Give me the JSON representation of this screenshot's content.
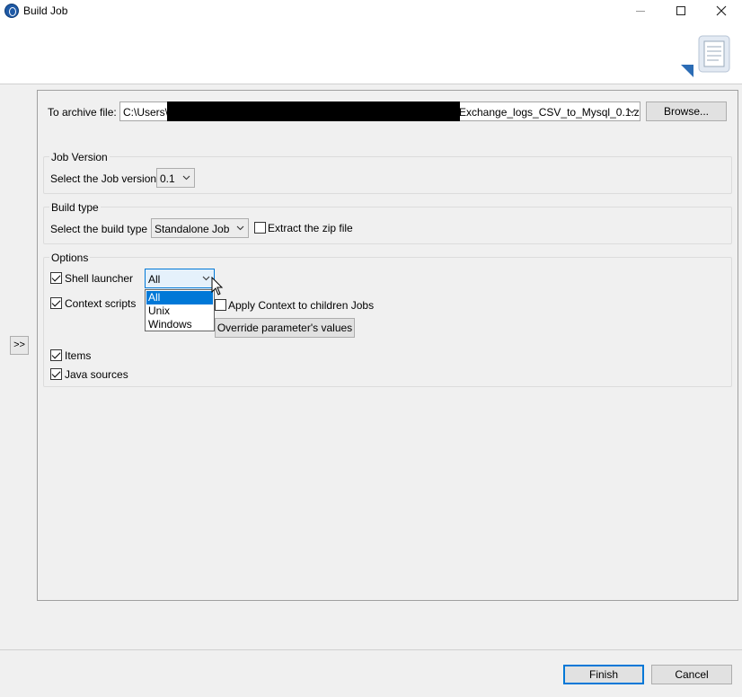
{
  "window": {
    "title": "Build Job"
  },
  "side_toggle": {
    "label": ">>"
  },
  "archive": {
    "label": "To archive file:",
    "path_start": "C:\\Users\\",
    "path_end": "Exchange_logs_CSV_to_Mysql_0.1.z",
    "browse_label": "Browse..."
  },
  "job_version": {
    "legend": "Job Version",
    "label": "Select the Job version",
    "value": "0.1"
  },
  "build_type": {
    "legend": "Build type",
    "label": "Select the build type",
    "value": "Standalone Job",
    "extract_label": "Extract the zip file",
    "extract_checked": false
  },
  "options": {
    "legend": "Options",
    "shell_launcher_label": "Shell launcher",
    "shell_launcher_value": "All",
    "shell_launcher_options": [
      "All",
      "Unix",
      "Windows"
    ],
    "context_scripts_label": "Context scripts",
    "apply_context_label": "Apply Context to children Jobs",
    "override_label": "Override parameter's values",
    "items_label": "Items",
    "java_sources_label": "Java sources"
  },
  "footer": {
    "finish_label": "Finish",
    "cancel_label": "Cancel"
  },
  "colors": {
    "accent": "#0078d7",
    "panel_bg": "#f0f0f0"
  },
  "icons": [
    "app-logo-icon",
    "minimize-icon",
    "maximize-icon",
    "close-icon",
    "export-banner-icon",
    "chevron-down-icon",
    "mouse-cursor-icon"
  ]
}
